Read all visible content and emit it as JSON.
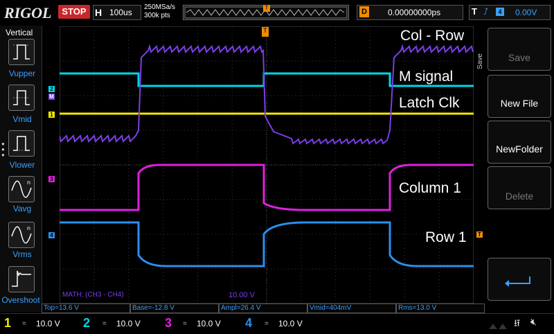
{
  "header": {
    "logo": "RIGOL",
    "run_state": "STOP",
    "timebase_label": "H",
    "timebase": "100us",
    "sample_rate": "250MSa/s",
    "memory_depth": "300k pts",
    "trigger_pos_marker": "T",
    "delay_label": "D",
    "delay": "0.00000000ps",
    "trigger_label": "T",
    "trigger_source": "4",
    "trigger_level": "0.00V"
  },
  "left_panel": {
    "title": "Vertical",
    "items": [
      {
        "label": "Vupper",
        "icon": "vupper-icon"
      },
      {
        "label": "Vmid",
        "icon": "vmid-icon"
      },
      {
        "label": "Vlower",
        "icon": "vlower-icon"
      },
      {
        "label": "Vavg",
        "icon": "vavg-icon"
      },
      {
        "label": "Vrms",
        "icon": "vrms-icon"
      },
      {
        "label": "Overshoot",
        "icon": "overshoot-icon"
      }
    ]
  },
  "right_panel": {
    "tab": "Save",
    "buttons": [
      {
        "label": "Save",
        "enabled": false
      },
      {
        "label": "New File",
        "enabled": true
      },
      {
        "label": "NewFolder",
        "enabled": true
      },
      {
        "label": "Delete",
        "enabled": false
      },
      {
        "label": "",
        "icon": "enter-arrow-icon",
        "enabled": true
      }
    ]
  },
  "annotations": {
    "col_row": "Col - Row",
    "m_signal": "M signal",
    "latch_clk": "Latch Clk",
    "column_1": "Column 1",
    "row_1": "Row 1"
  },
  "channel_markers": {
    "ch1": "1",
    "ch2": "2",
    "ch3": "3",
    "ch4": "4",
    "math": "M",
    "trigger_level_marker": "T"
  },
  "math": {
    "label": "MATH: (CH3 - CH4)",
    "scale": "10.00 V"
  },
  "measurements": [
    "Top=13.6 V",
    "Base=-12.8 V",
    "Ampl=26.4 V",
    "Vmid=404mV",
    "Rms=13.0 V"
  ],
  "channels": [
    {
      "num": "1",
      "coupling": "=",
      "scale": "10.0 V",
      "color": "#f4e800"
    },
    {
      "num": "2",
      "coupling": "=",
      "scale": "10.0 V",
      "color": "#00d8e8"
    },
    {
      "num": "3",
      "coupling": "=",
      "scale": "10.0 V",
      "color": "#e020e0"
    },
    {
      "num": "4",
      "coupling": "=",
      "scale": "10.0 V",
      "color": "#2a8ff0"
    }
  ],
  "colors": {
    "ch1": "#f4e800",
    "ch2": "#00d8e8",
    "ch3": "#e020e0",
    "ch4": "#2a8ff0",
    "math": "#7a3ee8",
    "accent": "#f08a00"
  }
}
